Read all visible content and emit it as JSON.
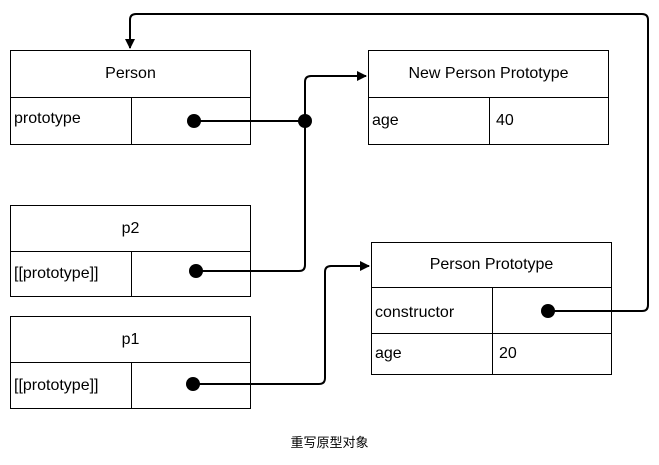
{
  "boxes": {
    "person": {
      "title": "Person",
      "rows": [
        {
          "label": "prototype",
          "value": ""
        }
      ]
    },
    "new_person_prototype": {
      "title": "New Person Prototype",
      "rows": [
        {
          "label": "age",
          "value": "40"
        }
      ]
    },
    "p2": {
      "title": "p2",
      "rows": [
        {
          "label": "[[prototype]]",
          "value": ""
        }
      ]
    },
    "p1": {
      "title": "p1",
      "rows": [
        {
          "label": "[[prototype]]",
          "value": ""
        }
      ]
    },
    "person_prototype": {
      "title": "Person Prototype",
      "rows": [
        {
          "label": "constructor",
          "value": ""
        },
        {
          "label": "age",
          "value": "20"
        }
      ]
    }
  },
  "links": [
    {
      "from": "person.prototype",
      "to": "new_person_prototype"
    },
    {
      "from": "p2.[[prototype]]",
      "to": "new_person_prototype"
    },
    {
      "from": "p1.[[prototype]]",
      "to": "person_prototype"
    },
    {
      "from": "person_prototype.constructor",
      "to": "person"
    }
  ],
  "caption": "重写原型对象"
}
